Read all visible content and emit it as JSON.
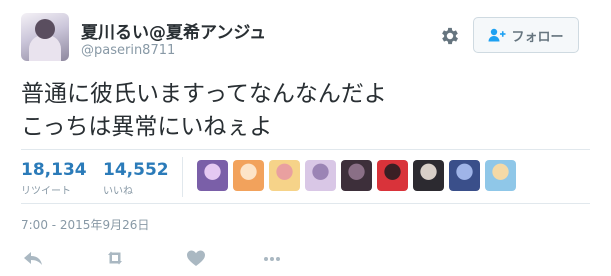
{
  "user": {
    "display_name": "夏川るい@夏希アンジュ",
    "screen_name": "@paserin8711"
  },
  "follow_button": {
    "label": "フォロー",
    "icon": "person-plus-icon"
  },
  "settings_icon": "gear-icon",
  "tweet": {
    "lines": [
      "普通に彼氏いますってなんなんだよ",
      "こっちは異常にいねぇよ"
    ]
  },
  "stats": {
    "retweets": {
      "count": "18,134",
      "label": "リツイート"
    },
    "likes": {
      "count": "14,552",
      "label": "いいね"
    }
  },
  "likers": [
    {
      "color": "#7a5fa8",
      "accent": "#e5c9f2"
    },
    {
      "color": "#f2a25c",
      "accent": "#fde4c8"
    },
    {
      "color": "#f6d389",
      "accent": "#e9a0a0"
    },
    {
      "color": "#d9c7e6",
      "accent": "#9b84b5"
    },
    {
      "color": "#3d2f3a",
      "accent": "#8a6f86"
    },
    {
      "color": "#d9333a",
      "accent": "#3a1f24"
    },
    {
      "color": "#2c2a30",
      "accent": "#d8cfc8"
    },
    {
      "color": "#3a4f8a",
      "accent": "#9fb4e8"
    },
    {
      "color": "#8fc7e8",
      "accent": "#f4d9a6"
    }
  ],
  "timestamp": "7:00 - 2015年9月26日",
  "actions": [
    "reply-icon",
    "retweet-icon",
    "like-heart-icon",
    "more-dots-icon"
  ],
  "colors": {
    "link": "#2b7bb9",
    "muted": "#8899a6",
    "icon": "#aab8c2",
    "text": "#292f33"
  }
}
